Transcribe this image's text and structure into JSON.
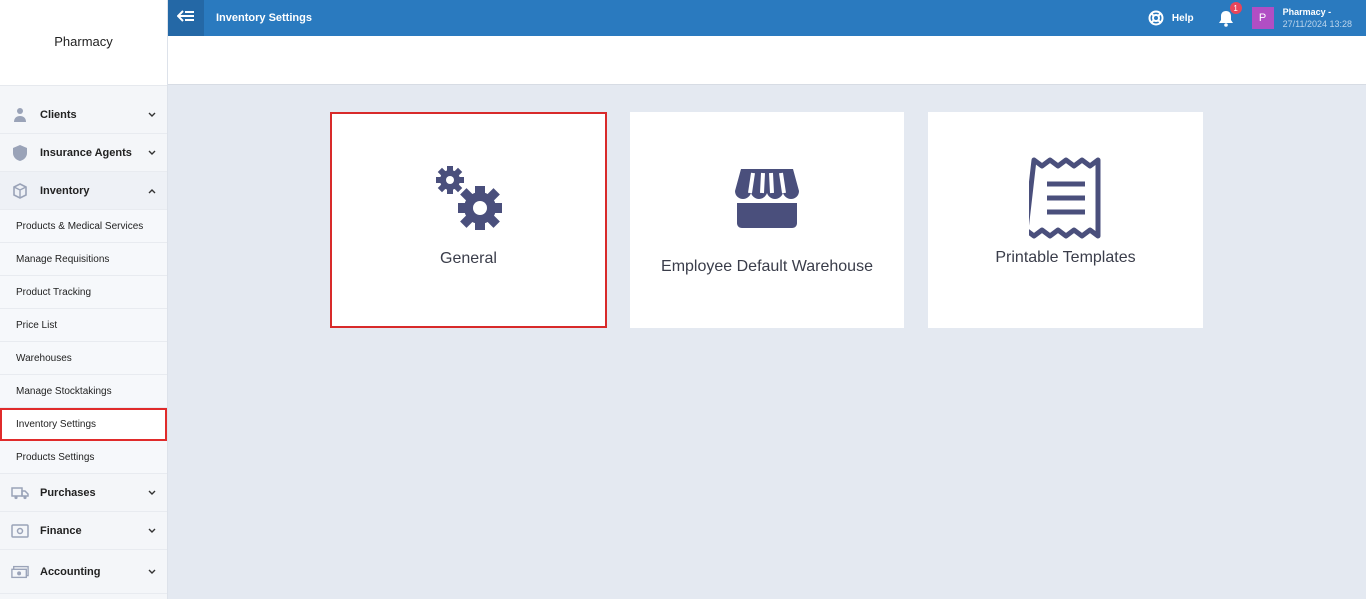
{
  "app": {
    "name": "Pharmacy"
  },
  "header": {
    "title": "Inventory Settings",
    "help_label": "Help",
    "notification_count": "1",
    "user": {
      "avatar_letter": "P",
      "name": "Pharmacy -",
      "datetime": "27/11/2024 13:28"
    }
  },
  "sidebar": {
    "items": [
      {
        "label": "Clients",
        "icon": "user-icon"
      },
      {
        "label": "Insurance Agents",
        "icon": "shield-icon"
      },
      {
        "label": "Inventory",
        "icon": "box-icon"
      },
      {
        "label": "Purchases",
        "icon": "truck-icon"
      },
      {
        "label": "Finance",
        "icon": "safe-icon"
      },
      {
        "label": "Accounting",
        "icon": "money-icon"
      }
    ],
    "inventory_sub": [
      "Products & Medical Services",
      "Manage Requisitions",
      "Product Tracking",
      "Price List",
      "Warehouses",
      "Manage Stocktakings",
      "Inventory Settings",
      "Products Settings"
    ]
  },
  "cards": [
    {
      "label": "General",
      "icon": "gears-icon"
    },
    {
      "label": "Employee Default Warehouse",
      "icon": "store-icon"
    },
    {
      "label": "Printable Templates",
      "icon": "receipt-icon"
    }
  ],
  "colors": {
    "topbar": "#2a7abf",
    "icon": "#4a4f7c",
    "highlight": "#d82a2a",
    "avatar": "#b14ec4"
  }
}
